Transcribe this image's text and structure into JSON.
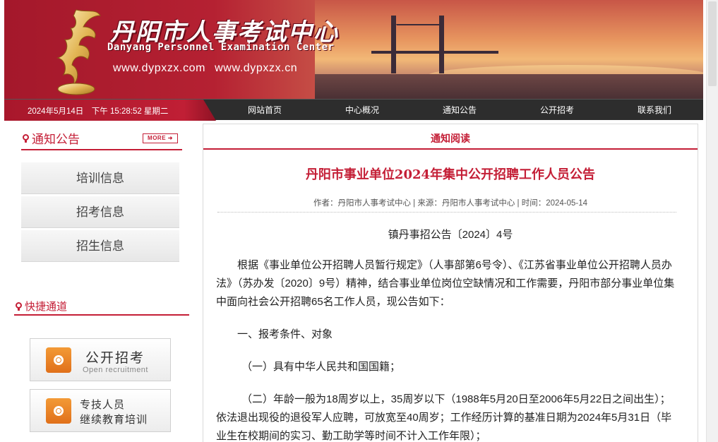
{
  "header": {
    "title_cn": "丹阳市人事考试中心",
    "title_en": "Danyang Personnel Examination Center",
    "urls": "www.dypxzx.com www.dypxzx.cn"
  },
  "navbar": {
    "datetime": "2024年5月14日　下午 15:28:52 星期二",
    "items": [
      "网站首页",
      "中心概况",
      "通知公告",
      "公开招考",
      "联系我们"
    ]
  },
  "sidebar": {
    "notice_title": "通知公告",
    "more_label": "MORE ➜",
    "items": [
      "培训信息",
      "招考信息",
      "招生信息"
    ],
    "quick_title": "快捷通道",
    "quick_links": [
      {
        "title": "公开招考",
        "subtitle": "Open recruitment"
      },
      {
        "line1": "专技人员",
        "line2": "继续教育培训"
      }
    ]
  },
  "article": {
    "section_label": "通知阅读",
    "title": "丹阳市事业单位2024年集中公开招聘工作人员公告",
    "meta": "作者：丹阳市人事考试中心 | 来源：丹阳市人事考试中心 | 时间：2024-05-14",
    "doc_number": "镇丹事招公告〔2024〕4号",
    "paragraphs": [
      "根据《事业单位公开招聘人员暂行规定》（人事部第6号令）、《江苏省事业单位公开招聘人员办法》（苏办发〔2020〕9号）精神，结合事业单位岗位空缺情况和工作需要，丹阳市部分事业单位集中面向社会公开招聘65名工作人员，现公告如下：",
      "一、报考条件、对象",
      "（一）具有中华人民共和国国籍；",
      "（二）年龄一般为18周岁以上，35周岁以下（1988年5月20日至2006年5月22日之间出生）；依法退出现役的退役军人应聘，可放宽至40周岁；工作经历计算的基准日期为2024年5月31日（毕业生在校期间的实习、勤工助学等时间不计入工作年限）；"
    ]
  }
}
